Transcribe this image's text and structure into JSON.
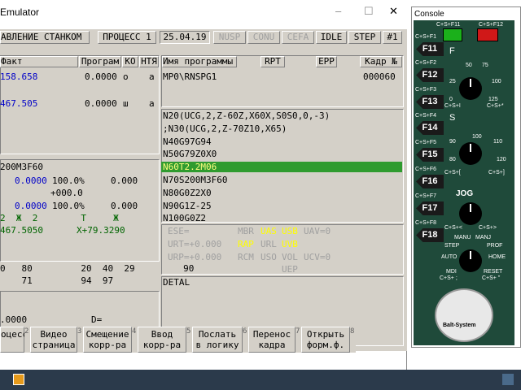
{
  "window": {
    "title": "Emulator",
    "min": "–",
    "max": "☐",
    "close": "✕"
  },
  "header": {
    "mode": "АВЛЕНИЕ СТАНКОМ",
    "process": "ПРОЦЕСС 1",
    "date": "25.04.19",
    "nusp": "NUSP",
    "conu": "CONU",
    "cefa": "CEFA",
    "idle": "IDLE",
    "step": "STEP",
    "num": "#1"
  },
  "coords": {
    "col_fact": "Факт",
    "col_prog": "Програм",
    "col_ko": "КО",
    "col_htn": "НТЯ",
    "r1_fact": "158.658",
    "r1_prog": "0.0000",
    "r1_ko": "о",
    "r1_htn": "a",
    "r2_fact": "467.505",
    "r2_prog": "0.0000",
    "r2_ko": "ш",
    "r2_htn": "a"
  },
  "program": {
    "col_name": "Имя программы",
    "col_rpt": "RPT",
    "col_epp": "EPP",
    "col_frame": "Кадр №",
    "name": "MP0\\RNSPG1",
    "frame": "000060"
  },
  "code": {
    "lines": [
      "N20(UCG,2,Z-60Z,X60X,S0S0,0,-3)",
      ";N30(UCG,2,Z-70Z10,X65)",
      "N40G97G94",
      "N50G79Z0X0",
      "N60T2.2M06",
      "N70S200M3F60",
      "N80G0Z2X0",
      "N90G1Z-25",
      "N100G0Z2"
    ]
  },
  "spindle": {
    "header": "200M3F60",
    "r1_a": "0.0000",
    "r1_b": "100.0%",
    "r1_c": "0.000",
    "r2": "+000.0",
    "r3_a": "0.0000",
    "r3_b": "100.0%",
    "r3_c": "0.000",
    "r4": "2  Ж  2        T     Ж",
    "r5_a": "467.5050",
    "r5_b": "X+79.3290"
  },
  "status": {
    "ese": "ESE=",
    "urt": "URT=+0.000",
    "urp": "URP=+0.000",
    "mbr": "MBR",
    "uas": "UAS",
    "usb": "USB",
    "uav": "UAV=0",
    "rap": "RAP",
    "url": "URL",
    "uvb": "UVB",
    "rcm": "RCM",
    "uso": "USO",
    "vol": "VOL",
    "ucv": "UCV=0",
    "uep": "UEP"
  },
  "nums": {
    "r1": "0   80         20  40  29         90",
    "r2": "    71         94  97"
  },
  "detal": "DETAL",
  "bottom": {
    "val": ".0000",
    "d": "D="
  },
  "fkeys": [
    {
      "n": "",
      "l1": "оцесс",
      "l2": ""
    },
    {
      "n": "2",
      "l1": "Видео",
      "l2": "страница"
    },
    {
      "n": "3",
      "l1": "Смещение",
      "l2": "корр-ра"
    },
    {
      "n": "4",
      "l1": "Ввод",
      "l2": "корр-ра"
    },
    {
      "n": "5",
      "l1": "Послать",
      "l2": "в логику"
    },
    {
      "n": "6",
      "l1": "Перенос",
      "l2": "кадра"
    },
    {
      "n": "7",
      "l1": "Открыть",
      "l2": "форм.ф."
    },
    {
      "n": "8",
      "l1": "",
      "l2": ""
    }
  ],
  "console": {
    "title": "Console",
    "keys": [
      "F11",
      "F12",
      "F13",
      "F14",
      "F15",
      "F16",
      "F17",
      "F18"
    ],
    "mods": [
      "C+S+F1",
      "C+S+F2",
      "C+S+F3",
      "C+S+F4",
      "C+S+F5",
      "C+S+F6",
      "C+S+F7",
      "C+S+F8"
    ],
    "cs11": "C+S+F11",
    "cs12": "C+S+F12",
    "jog": "JOG",
    "manu": "MANU",
    "manj": "MANJ",
    "step": "STEP",
    "prof": "PROF",
    "auto": "AUTO",
    "home": "HOME",
    "mdi": "MDI",
    "reset": "RESET",
    "brand": "Balt-System",
    "f_lbl": "F",
    "s_lbl": "S",
    "dial1": [
      "50",
      "75",
      "25",
      "100",
      "0",
      "125",
      "C+S+I",
      "C+S+*"
    ],
    "dial2": [
      "100",
      "110",
      "90",
      "120",
      "80",
      "C+S+[",
      "C+S+]"
    ],
    "cslt": "C+S+<",
    "csgt": "C+S+>",
    "cs_semi": "C+S+ ;",
    "cs_quote": "C+S+ \""
  }
}
